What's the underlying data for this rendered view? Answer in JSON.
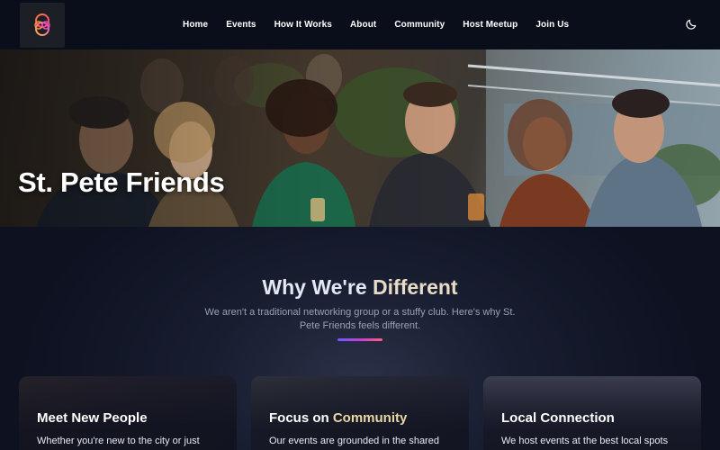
{
  "nav": {
    "logo_icon": "interlocking-rings-logo-icon",
    "links": [
      "Home",
      "Events",
      "How It Works",
      "About",
      "Community",
      "Host Meetup",
      "Join Us"
    ],
    "theme_icon": "moon-icon"
  },
  "hero": {
    "title": "St. Pete Friends"
  },
  "why": {
    "title_part1": "Why We're ",
    "title_part2": "Different",
    "subtitle": "We aren't a traditional networking group or a stuffy club. Here's why St. Pete Friends feels different."
  },
  "cards": [
    {
      "title": "Meet New People",
      "title_highlight": "",
      "text": "Whether you're new to the city or just"
    },
    {
      "title": "Focus on ",
      "title_highlight": "Community",
      "text": "Our events are grounded in the shared"
    },
    {
      "title": "Local Connection",
      "title_highlight": "",
      "text": "We host events at the best local spots"
    }
  ],
  "colors": {
    "background": "#0b0f1e",
    "nav_background": "#0a0d1a",
    "accent_gradient_start": "#6b5cff",
    "accent_gradient_end": "#ff5e7e",
    "highlight_text": "#e9d8a6"
  }
}
